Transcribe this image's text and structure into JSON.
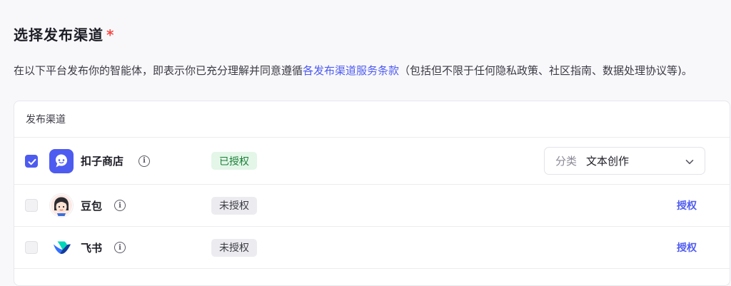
{
  "section": {
    "title": "选择发布渠道",
    "required_mark": "*",
    "desc_prefix": "在以下平台发布你的智能体，即表示你已充分理解并同意遵循",
    "desc_link": "各发布渠道服务条款",
    "desc_suffix": "（包括但不限于任何隐私政策、社区指南、数据处理协议等)。"
  },
  "table": {
    "header": "发布渠道",
    "rows": [
      {
        "name": "扣子商店",
        "checked": true,
        "status": "已授权",
        "icon": "kouzi-logo-icon",
        "category_label": "分类",
        "category_value": "文本创作"
      },
      {
        "name": "豆包",
        "checked": false,
        "status": "未授权",
        "icon": "doubao-logo-icon",
        "action": "授权"
      },
      {
        "name": "飞书",
        "checked": false,
        "status": "未授权",
        "icon": "feishu-logo-icon",
        "action": "授权"
      }
    ]
  },
  "colors": {
    "accent": "#4e5bf0",
    "required": "#f54a45",
    "authorized_bg": "#e3f6e8",
    "authorized_text": "#1a7f37"
  }
}
